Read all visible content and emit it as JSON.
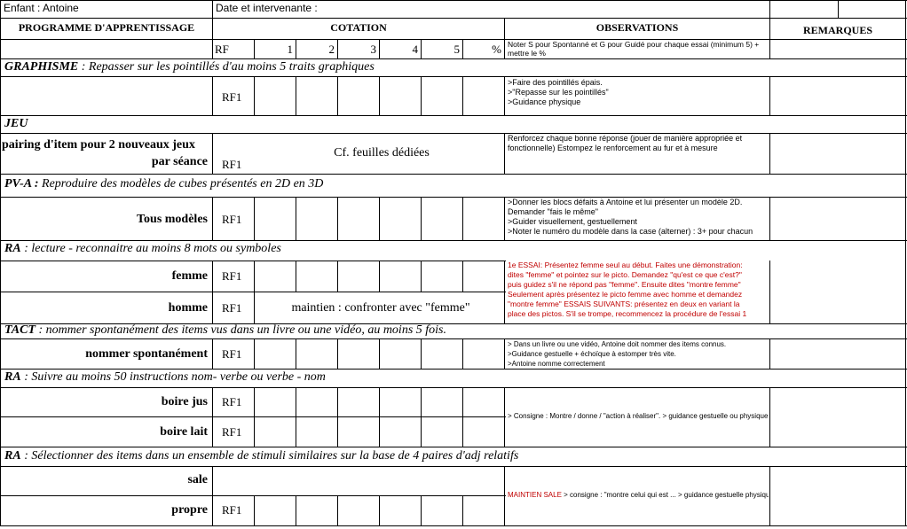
{
  "top": {
    "enfant": "Enfant :  Antoine",
    "date": "Date et intervenante :"
  },
  "header": {
    "programme": "PROGRAMME  D'APPRENTISSAGE",
    "cotation": "COTATION",
    "observations": "OBSERVATIONS",
    "remarques": "REMARQUES",
    "rf": "RF",
    "cols": [
      "1",
      "2",
      "3",
      "4",
      "5",
      "%"
    ],
    "obs_note": "Noter S pour Spontanné et G pour Guidé pour chaque  essai (minimum 5) + mettre le %"
  },
  "sections": {
    "graphisme": {
      "title": "GRAPHISME",
      "desc": " : Repasser sur les pointillés d'au moins 5 traits graphiques",
      "rf": "RF1",
      "obs": [
        ">Faire des pointillés épais.",
        ">\"Repasse sur les pointillés\"",
        ">Guidance physique"
      ]
    },
    "jeu": {
      "title": "JEU",
      "label_line1": "pairing d'item pour 2 nouveaux jeux",
      "label_line2": "par séance",
      "rf": "RF1",
      "cf": "Cf. feuilles dédiées",
      "obs": "Renforcez chaque bonne réponse (jouer de manière appropriée et fonctionnelle) Estompez le renforcement au fur et à mesure"
    },
    "pva": {
      "title": "PV-A :",
      "desc": " Reproduire des modèles de cubes présentés en 2D en 3D",
      "label": "Tous modèles",
      "rf": "RF1",
      "obs": [
        ">Donner les blocs défaits à Antoine et lui présenter un modèle 2D.",
        "Demander \"fais le même\"",
        ">Guider visuellement, gestuellement",
        ">Noter le numéro du modèle dans la case (alterner) : 3+ pour chacun"
      ]
    },
    "ra1": {
      "title": "RA",
      "desc": "  : lecture - reconnaitre au moins 8 mots ou symboles",
      "row1": {
        "label": "femme",
        "rf": "RF1"
      },
      "row2": {
        "label": "homme",
        "rf": "RF1",
        "note": "maintien : confronter avec \"femme\""
      },
      "obs": [
        "1e ESSAI: Présentez femme seul au début. Faites une démonstration:",
        "dites \"femme\" et pointez sur le picto. Demandez \"qu'est ce que c'est?\"",
        "puis guidez s'il ne répond pas \"femme\". Ensuite dites \"montre femme\"",
        "Seulement après présentez le picto femme avec homme et demandez",
        "\"montre femme\" ESSAIS SUIVANTS: présentez en deux en variant la",
        "place des pictos. S'il se trompe, recommencez la procédure de l'essai 1"
      ]
    },
    "tact": {
      "title": "TACT",
      "desc": " : nommer spontanément des items vus dans un livre ou une vidéo, au moins 5 fois.",
      "label": "nommer spontanément",
      "rf": "RF1",
      "obs": [
        "> Dans un livre ou une vidéo, Antoine doit nommer des items connus.",
        ">Guidance gestuelle + échoïque à estomper très vite.",
        ">Antoine nomme correctement"
      ]
    },
    "ra2": {
      "title": "RA",
      "desc": " : Suivre au moins 50 instructions nom- verbe ou verbe - nom",
      "row1": {
        "label": "boire jus",
        "rf": "RF1"
      },
      "row2": {
        "label": "boire lait",
        "rf": "RF1"
      },
      "obs": "> Consigne : Montre / donne / \"action à réaliser\". > guidance gestuelle ou physique"
    },
    "ra3": {
      "title": "RA",
      "desc": " : Sélectionner des items dans un ensemble de stimuli similaires sur la base de 4 paires d'adj relatifs",
      "row1": {
        "label": "sale",
        "rf": ""
      },
      "row2": {
        "label": "propre",
        "rf": "RF1"
      },
      "obs_red": "MAINTIEN SALE",
      "obs_rest": " > consigne : \"montre celui qui  est ... > guidance gestuelle  physique"
    }
  }
}
